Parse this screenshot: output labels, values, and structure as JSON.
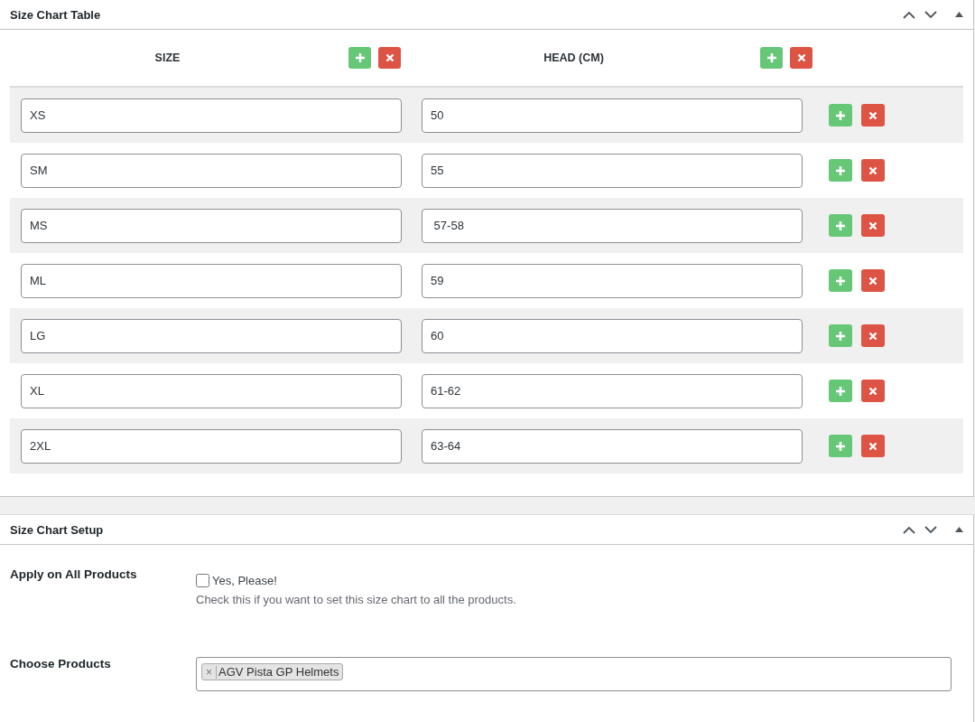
{
  "size_chart_table": {
    "title": "Size Chart Table",
    "columns": [
      {
        "label": "SIZE"
      },
      {
        "label": "HEAD (CM)"
      }
    ],
    "rows": [
      {
        "cells": [
          "XS",
          "50"
        ]
      },
      {
        "cells": [
          "SM",
          "55"
        ]
      },
      {
        "cells": [
          "MS",
          " 57-58"
        ]
      },
      {
        "cells": [
          "ML",
          "59"
        ]
      },
      {
        "cells": [
          "LG",
          "60"
        ]
      },
      {
        "cells": [
          "XL",
          "61-62"
        ]
      },
      {
        "cells": [
          "2XL",
          "63-64"
        ]
      }
    ]
  },
  "size_chart_setup": {
    "title": "Size Chart Setup",
    "apply_all": {
      "label": "Apply on All Products",
      "checkbox_label": "Yes, Please!",
      "checked": false,
      "description": "Check this if you want to set this size chart to all the products."
    },
    "choose_products": {
      "label": "Choose Products",
      "tags": [
        {
          "label": "AGV Pista GP Helmets",
          "remove": "×"
        }
      ]
    }
  }
}
